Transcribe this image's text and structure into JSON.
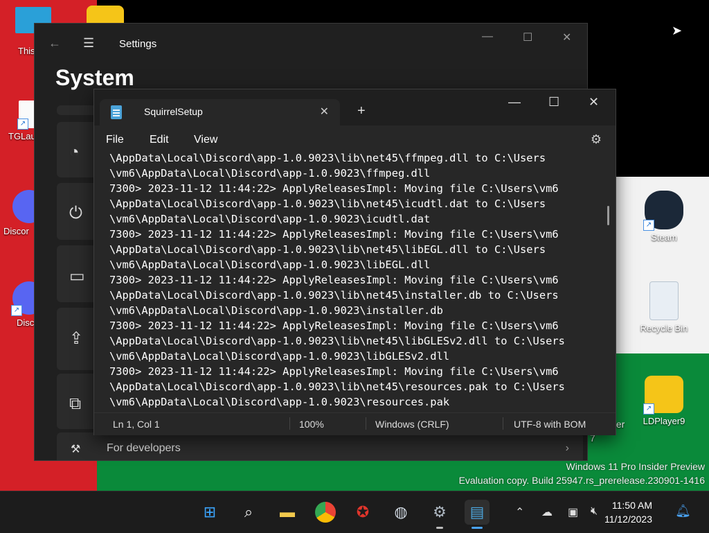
{
  "desktop": {
    "watermark_line1": "Windows 11 Pro Insider Preview",
    "watermark_line2": "Evaluation copy. Build 25947.rs_prerelease.230901-1416",
    "icons": [
      {
        "label": "This",
        "icon": "monitor-icon"
      },
      {
        "label": "TGLau",
        "icon": "tglauncher-icon"
      },
      {
        "label": "Discor",
        "icon": "discord-icon"
      },
      {
        "label": "Disc",
        "icon": "discord-icon"
      },
      {
        "label": "Steam",
        "icon": "steam-icon"
      },
      {
        "label": "Recycle Bin",
        "icon": "recycle-bin-icon"
      },
      {
        "label": "LDPlayer9",
        "icon": "ldplayer-icon"
      },
      {
        "label": "ter",
        "icon": "partial-icon"
      },
      {
        "label": "7",
        "icon": "partial-icon"
      }
    ]
  },
  "settings": {
    "title": "Settings",
    "heading": "System",
    "visible_item": "For developers"
  },
  "notepad": {
    "tab_title": "SquirrelSetup",
    "menu": [
      "File",
      "Edit",
      "View"
    ],
    "lines": [
      "\\AppData\\Local\\Discord\\app-1.0.9023\\lib\\net45\\ffmpeg.dll to C:\\Users",
      "\\vm6\\AppData\\Local\\Discord\\app-1.0.9023\\ffmpeg.dll",
      "7300> 2023-11-12 11:44:22> ApplyReleasesImpl: Moving file C:\\Users\\vm6",
      "\\AppData\\Local\\Discord\\app-1.0.9023\\lib\\net45\\icudtl.dat to C:\\Users",
      "\\vm6\\AppData\\Local\\Discord\\app-1.0.9023\\icudtl.dat",
      "7300> 2023-11-12 11:44:22> ApplyReleasesImpl: Moving file C:\\Users\\vm6",
      "\\AppData\\Local\\Discord\\app-1.0.9023\\lib\\net45\\libEGL.dll to C:\\Users",
      "\\vm6\\AppData\\Local\\Discord\\app-1.0.9023\\libEGL.dll",
      "7300> 2023-11-12 11:44:22> ApplyReleasesImpl: Moving file C:\\Users\\vm6",
      "\\AppData\\Local\\Discord\\app-1.0.9023\\lib\\net45\\installer.db to C:\\Users",
      "\\vm6\\AppData\\Local\\Discord\\app-1.0.9023\\installer.db",
      "7300> 2023-11-12 11:44:22> ApplyReleasesImpl: Moving file C:\\Users\\vm6",
      "\\AppData\\Local\\Discord\\app-1.0.9023\\lib\\net45\\libGLESv2.dll to C:\\Users",
      "\\vm6\\AppData\\Local\\Discord\\app-1.0.9023\\libGLESv2.dll",
      "7300> 2023-11-12 11:44:22> ApplyReleasesImpl: Moving file C:\\Users\\vm6",
      "\\AppData\\Local\\Discord\\app-1.0.9023\\lib\\net45\\resources.pak to C:\\Users",
      "\\vm6\\AppData\\Local\\Discord\\app-1.0.9023\\resources.pak"
    ],
    "status": {
      "position": "Ln 1, Col 1",
      "zoom": "100%",
      "line_ending": "Windows (CRLF)",
      "encoding": "UTF-8 with BOM"
    }
  },
  "taskbar": {
    "time": "11:50 AM",
    "date": "11/12/2023"
  }
}
